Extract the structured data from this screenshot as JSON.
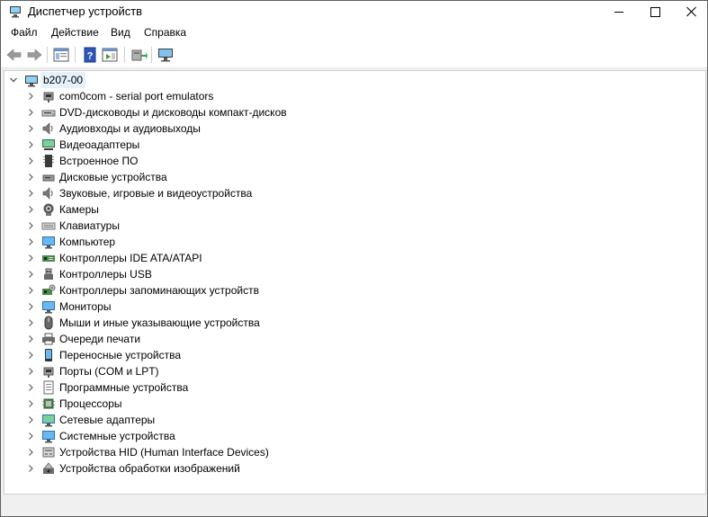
{
  "window": {
    "title": "Диспетчер устройств"
  },
  "menu": [
    {
      "label": "Файл"
    },
    {
      "label": "Действие"
    },
    {
      "label": "Вид"
    },
    {
      "label": "Справка"
    }
  ],
  "tree": {
    "root": "b207-00",
    "items": [
      {
        "label": "com0com - serial port emulators",
        "icon": "port-icon"
      },
      {
        "label": "DVD-дисководы и дисководы компакт-дисков",
        "icon": "dvd-drive-icon"
      },
      {
        "label": "Аудиовходы и аудиовыходы",
        "icon": "speaker-icon"
      },
      {
        "label": "Видеоадаптеры",
        "icon": "display-adapter-icon"
      },
      {
        "label": "Встроенное ПО",
        "icon": "firmware-icon"
      },
      {
        "label": "Дисковые устройства",
        "icon": "disk-drive-icon"
      },
      {
        "label": "Звуковые, игровые и видеоустройства",
        "icon": "speaker-icon"
      },
      {
        "label": "Камеры",
        "icon": "camera-icon"
      },
      {
        "label": "Клавиатуры",
        "icon": "keyboard-icon"
      },
      {
        "label": "Компьютер",
        "icon": "computer-icon"
      },
      {
        "label": "Контроллеры IDE ATA/ATAPI",
        "icon": "ide-controller-icon"
      },
      {
        "label": "Контроллеры USB",
        "icon": "usb-icon"
      },
      {
        "label": "Контроллеры запоминающих устройств",
        "icon": "storage-controller-icon"
      },
      {
        "label": "Мониторы",
        "icon": "monitor-icon"
      },
      {
        "label": "Мыши и иные указывающие устройства",
        "icon": "mouse-icon"
      },
      {
        "label": "Очереди печати",
        "icon": "printer-icon"
      },
      {
        "label": "Переносные устройства",
        "icon": "portable-device-icon"
      },
      {
        "label": "Порты (COM и LPT)",
        "icon": "port-icon"
      },
      {
        "label": "Программные устройства",
        "icon": "software-device-icon"
      },
      {
        "label": "Процессоры",
        "icon": "processor-icon"
      },
      {
        "label": "Сетевые адаптеры",
        "icon": "network-adapter-icon"
      },
      {
        "label": "Системные устройства",
        "icon": "system-device-icon"
      },
      {
        "label": "Устройства HID (Human Interface Devices)",
        "icon": "hid-icon"
      },
      {
        "label": "Устройства обработки изображений",
        "icon": "imaging-device-icon"
      }
    ]
  }
}
